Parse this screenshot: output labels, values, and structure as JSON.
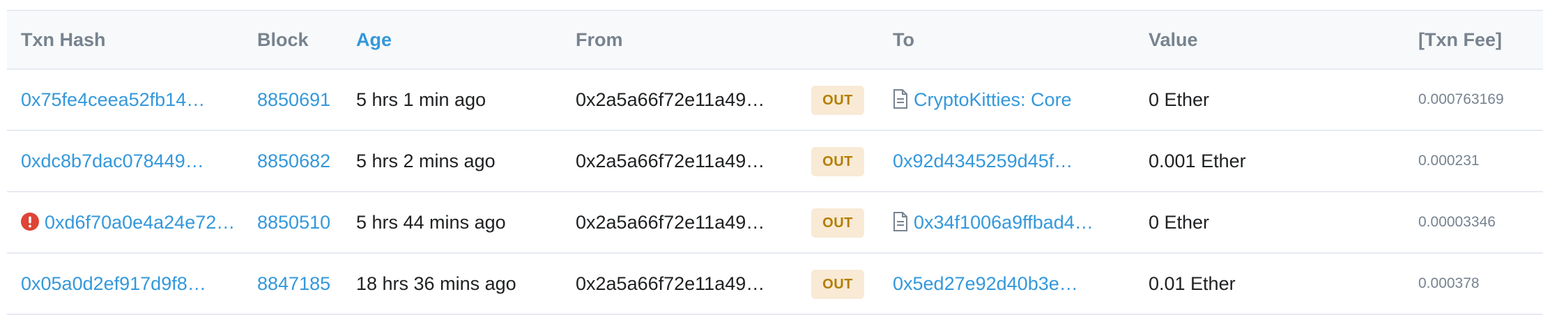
{
  "table": {
    "headers": {
      "txn_hash": "Txn Hash",
      "block": "Block",
      "age": "Age",
      "from": "From",
      "to": "To",
      "value": "Value",
      "txn_fee": "[Txn Fee]"
    },
    "rows": [
      {
        "error": false,
        "txn_hash": "0x75fe4ceea52fb14…",
        "block": "8850691",
        "age": "5 hrs 1 min ago",
        "from": "0x2a5a66f72e11a49…",
        "direction": "OUT",
        "to": "CryptoKitties: Core",
        "to_is_contract": true,
        "value": "0 Ether",
        "txn_fee": "0.000763169"
      },
      {
        "error": false,
        "txn_hash": "0xdc8b7dac078449…",
        "block": "8850682",
        "age": "5 hrs 2 mins ago",
        "from": "0x2a5a66f72e11a49…",
        "direction": "OUT",
        "to": "0x92d4345259d45f…",
        "to_is_contract": false,
        "value": "0.001 Ether",
        "txn_fee": "0.000231"
      },
      {
        "error": true,
        "txn_hash": "0xd6f70a0e4a24e72…",
        "block": "8850510",
        "age": "5 hrs 44 mins ago",
        "from": "0x2a5a66f72e11a49…",
        "direction": "OUT",
        "to": "0x34f1006a9ffbad4…",
        "to_is_contract": true,
        "value": "0 Ether",
        "txn_fee": "0.00003346"
      },
      {
        "error": false,
        "txn_hash": "0x05a0d2ef917d9f8…",
        "block": "8847185",
        "age": "18 hrs 36 mins ago",
        "from": "0x2a5a66f72e11a49…",
        "direction": "OUT",
        "to": "0x5ed27e92d40b3e…",
        "to_is_contract": false,
        "value": "0.01 Ether",
        "txn_fee": "0.000378"
      }
    ]
  },
  "colors": {
    "link": "#3498db",
    "header_text": "#77838f",
    "badge_bg": "#f8ead5",
    "badge_text": "#b47d00",
    "error": "#de4437"
  }
}
